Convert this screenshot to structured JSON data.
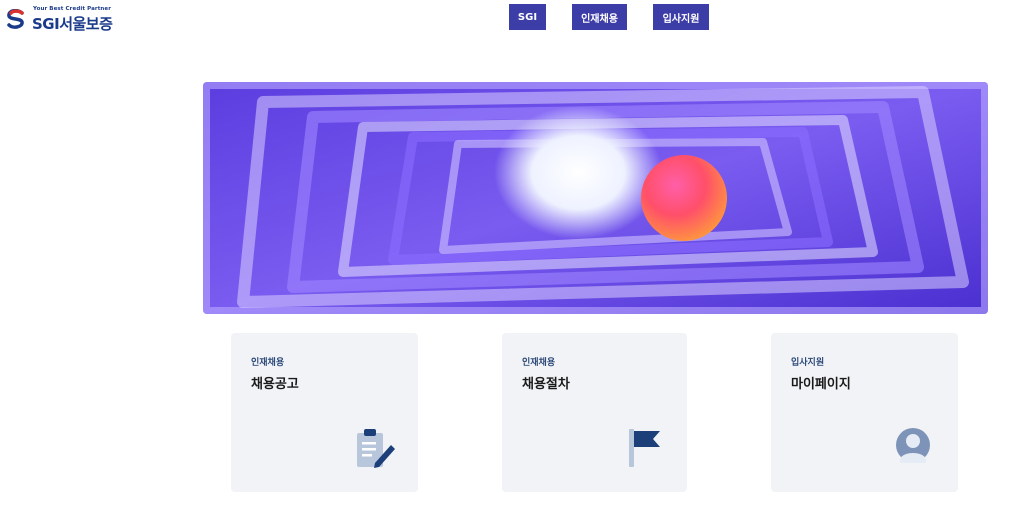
{
  "logo": {
    "tagline": "Your Best Credit Partner",
    "name": "SGI서울보증"
  },
  "nav": {
    "sgi": "SGI",
    "recruit": "인재채용",
    "apply": "입사지원"
  },
  "cards": [
    {
      "category": "인재채용",
      "title": "채용공고",
      "icon": "clipboard-icon"
    },
    {
      "category": "인재채용",
      "title": "채용절차",
      "icon": "flag-icon"
    },
    {
      "category": "입사지원",
      "title": "마이페이지",
      "icon": "user-icon"
    }
  ],
  "colors": {
    "nav_bg": "#3d3da8",
    "card_bg": "#f1f3f6",
    "brand_navy": "#1a3a8a",
    "brand_red": "#d9322f"
  }
}
